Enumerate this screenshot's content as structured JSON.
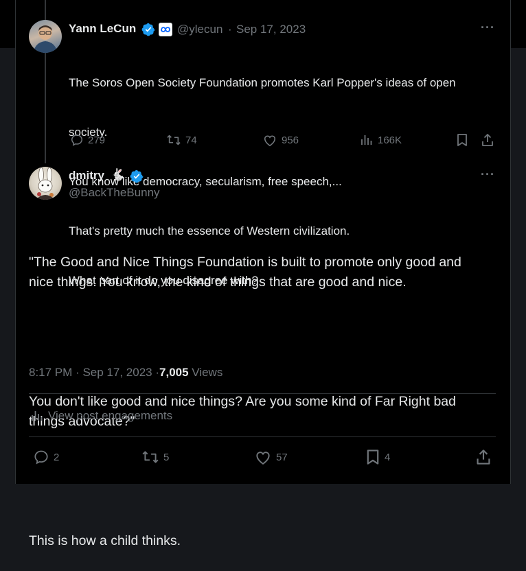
{
  "parent_tweet": {
    "author_name": "Yann LeCun",
    "handle": "@ylecun",
    "separator": "·",
    "date": "Sep 17, 2023",
    "lines": [
      "The Soros Open Society Foundation promotes Karl Popper's ideas of open",
      "society.",
      "You know like democracy, secularism, free speech,...",
      "That's pretty much the essence of Western civilization.",
      "What part of it do you disagree with?"
    ],
    "stats": {
      "replies": "279",
      "reposts": "74",
      "likes": "956",
      "views": "166K"
    }
  },
  "main_tweet": {
    "author_name": "dmitry",
    "name_emoji": "🐇",
    "handle": "@BackTheBunny",
    "paragraphs": [
      "\"The Good and Nice Things Foundation is built to promote only good and\nnice things. You know, the kind of things that are good and nice.",
      "You don't like good and nice things? Are you some kind of Far Right bad\nthings advocate?\"",
      "This is how a child thinks."
    ],
    "time": "8:17 PM",
    "separator": "·",
    "date": "Sep 17, 2023",
    "dot": "·",
    "views_count": "7,005",
    "views_label": "Views",
    "engagements_label": "View post engagements",
    "stats": {
      "replies": "2",
      "reposts": "5",
      "likes": "57",
      "bookmarks": "4"
    }
  },
  "colors": {
    "verified": "#1d9bf0",
    "text": "#e7e9ea",
    "muted": "#71767b",
    "divider": "#2f3336"
  },
  "icons": [
    "verified-badge-icon",
    "meta-affiliate-icon",
    "more-icon",
    "reply-icon",
    "repost-icon",
    "like-icon",
    "views-icon",
    "bookmark-icon",
    "share-icon",
    "analytics-icon"
  ]
}
